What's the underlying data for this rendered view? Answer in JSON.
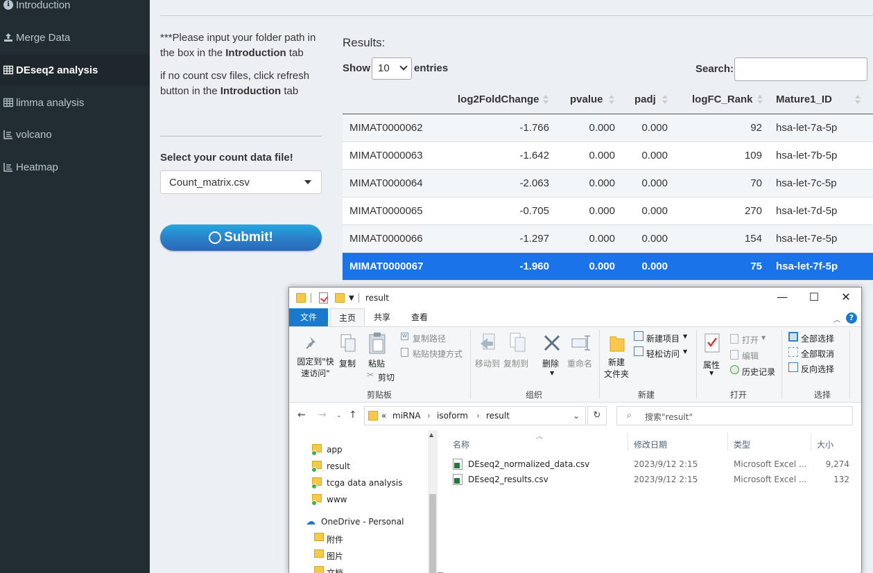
{
  "sidebar": {
    "items": [
      {
        "label": "Introduction",
        "icon": "info-circle-icon",
        "active": false
      },
      {
        "label": "Merge Data",
        "icon": "upload-icon",
        "active": false
      },
      {
        "label": "DEseq2 analysis",
        "icon": "table-icon",
        "active": true
      },
      {
        "label": "limma analysis",
        "icon": "table-icon",
        "active": false
      },
      {
        "label": "volcano",
        "icon": "line-chart-icon",
        "active": false
      },
      {
        "label": "Heatmap",
        "icon": "line-chart-icon",
        "active": false
      }
    ]
  },
  "panel": {
    "note_prefix": "***Please input your folder path in the box in the ",
    "note_bold": "Introduction",
    "note_suffix": " tab",
    "note2_prefix": "if no count csv files, click refresh button in the ",
    "note2_bold": "Introduction",
    "note2_suffix": " tab",
    "select_label": "Select your count data file!",
    "select_value": "Count_matrix.csv",
    "submit_label": "Submit!"
  },
  "results": {
    "title": "Results:",
    "show_label": "Show",
    "page_length": "10",
    "entries_label": "entries",
    "search_label": "Search:",
    "columns": [
      "",
      "log2FoldChange",
      "pvalue",
      "padj",
      "logFC_Rank",
      "Mature1_ID"
    ],
    "rows": [
      [
        "MIMAT0000062",
        "-1.766",
        "0.000",
        "0.000",
        "92",
        "hsa-let-7a-5p"
      ],
      [
        "MIMAT0000063",
        "-1.642",
        "0.000",
        "0.000",
        "109",
        "hsa-let-7b-5p"
      ],
      [
        "MIMAT0000064",
        "-2.063",
        "0.000",
        "0.000",
        "70",
        "hsa-let-7c-5p"
      ],
      [
        "MIMAT0000065",
        "-0.705",
        "0.000",
        "0.000",
        "270",
        "hsa-let-7d-5p"
      ],
      [
        "MIMAT0000066",
        "-1.297",
        "0.000",
        "0.000",
        "154",
        "hsa-let-7e-5p"
      ],
      [
        "MIMAT0000067",
        "-1.960",
        "0.000",
        "0.000",
        "75",
        "hsa-let-7f-5p"
      ]
    ],
    "selected_row": 5
  },
  "explorer": {
    "title": "result",
    "tabs": [
      "文件",
      "主页",
      "共享",
      "查看"
    ],
    "ribbon": {
      "pin_label": "固定到\"快速访问\"",
      "copy": "复制",
      "paste": "粘贴",
      "copy_path": "复制路径",
      "paste_shortcut": "粘贴快捷方式",
      "cut": "剪切",
      "clipboard_group": "剪贴板",
      "move_to": "移动到",
      "copy_to": "复制到",
      "delete": "删除",
      "rename": "重命名",
      "organize_group": "组织",
      "new_folder": "新建\n文件夹",
      "new_item": "新建项目",
      "easy_access": "轻松访问",
      "new_group": "新建",
      "properties": "属性",
      "open": "打开",
      "edit": "编辑",
      "history": "历史记录",
      "open_group": "打开",
      "select_all": "全部选择",
      "select_none": "全部取消",
      "invert": "反向选择",
      "select_group": "选择"
    },
    "address": [
      "«",
      "miRNA",
      "isoform",
      "result"
    ],
    "search_placeholder": "搜索\"result\"",
    "nav_items": [
      "app",
      "result",
      "tcga data analysis",
      "www",
      "OneDrive - Personal",
      "附件",
      "图片",
      "文档"
    ],
    "columns": [
      "名称",
      "修改日期",
      "类型",
      "大小"
    ],
    "files": [
      {
        "name": "DEseq2_normalized_data.csv",
        "date": "2023/9/12 2:15",
        "type": "Microsoft Excel ...",
        "size": "9,274"
      },
      {
        "name": "DEseq2_results.csv",
        "date": "2023/9/12 2:15",
        "type": "Microsoft Excel ...",
        "size": "132"
      }
    ]
  },
  "colors": {
    "sidebar_bg": "#222d32",
    "selected_row": "#1a73e8",
    "submit_button": "#2a7cc7",
    "ribbon_file_tab": "#1979ca"
  }
}
